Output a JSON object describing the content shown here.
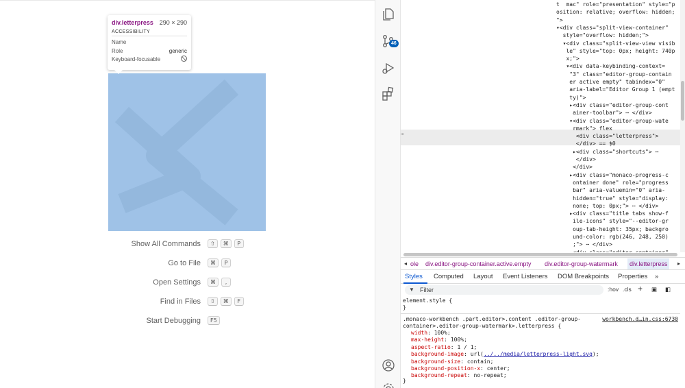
{
  "tooltip": {
    "tag": "div.letterpress",
    "dimensions": "290 × 290",
    "section": "ACCESSIBILITY",
    "rows": [
      {
        "label": "Name",
        "value": ""
      },
      {
        "label": "Role",
        "value": "generic"
      },
      {
        "label": "Keyboard-focusable",
        "value": ""
      }
    ]
  },
  "shortcuts": [
    {
      "label": "Show All Commands",
      "keys": [
        "⇧",
        "⌘",
        "P"
      ]
    },
    {
      "label": "Go to File",
      "keys": [
        "⌘",
        "P"
      ]
    },
    {
      "label": "Open Settings",
      "keys": [
        "⌘",
        ","
      ]
    },
    {
      "label": "Find in Files",
      "keys": [
        "⇧",
        "⌘",
        "F"
      ]
    },
    {
      "label": "Start Debugging",
      "keys": [
        "F5"
      ]
    }
  ],
  "activity_bar": {
    "icons": [
      "explorer-icon",
      "source-control-icon",
      "run-debug-icon",
      "extensions-icon",
      "accounts-icon",
      "manage-icon"
    ],
    "scm_badge": "46"
  },
  "dom_lines": [
    "t  mac\" role=\"presentation\" style=\"p",
    "osition: relative; overflow: hidden;",
    "\">",
    "▾<div class=\"split-view-container\"",
    "  style=\"overflow: hidden;\">",
    "  ▾<div class=\"split-view-view visib",
    "   le\" style=\"top: 0px; height: 740p",
    "   x;\">",
    "   ▾<div data-keybinding-context=",
    "    \"3\" class=\"editor-group-contain",
    "    er active empty\" tabindex=\"0\"",
    "    aria-label=\"Editor Group 1 (empt",
    "    ty)\">",
    "    ▸<div class=\"editor-group-cont",
    "     ainer-toolbar\"> ⋯ </div>",
    "    ▾<div class=\"editor-group-wate",
    "     rmark\"> flex",
    "      <div class=\"letterpress\">",
    "      </div> == $0",
    "     ▸<div class=\"shortcuts\"> ⋯ ",
    "      </div>",
    "     </div>",
    "    ▸<div class=\"monaco-progress-c",
    "     ontainer done\" role=\"progress",
    "     bar\" aria-valuemin=\"0\" aria-",
    "     hidden=\"true\" style=\"display:",
    "     none; top: 0px;\"> ⋯ </div>",
    "    ▸<div class=\"title tabs show-f",
    "     ile-icons\" style=\"--editor-gr",
    "     oup-tab-height: 35px; backgro",
    "     und-color: rgb(246, 248, 250)",
    "     ;\"> ⋯ </div>",
    "     <div class=\"editor-container\""
  ],
  "breadcrumbs": [
    "ole",
    "div.editor-group-container.active.empty",
    "div.editor-group-watermark",
    "div.letterpress"
  ],
  "tabs": [
    "Styles",
    "Computed",
    "Layout",
    "Event Listeners",
    "DOM Breakpoints",
    "Properties",
    "»"
  ],
  "filter": {
    "placeholder": "Filter",
    "hov": ":hov",
    "cls": ".cls",
    "plus": "+"
  },
  "styles": {
    "element_style_open": "element.style {",
    "element_style_close": "}",
    "rule_selector_1": ".monaco-workbench .part.editor>.content .editor-group-",
    "rule_selector_2": "container>.editor-group-watermark>.letterpress {",
    "rule_source": "workbench.d…in.css:6730",
    "declarations": [
      {
        "prop": "width",
        "value": "100%;"
      },
      {
        "prop": "max-height",
        "value": "100%;"
      },
      {
        "prop": "aspect-ratio",
        "value": "1 / 1;"
      },
      {
        "prop": "background-image",
        "value_prefix": "url(",
        "value_link": "../../media/letterpress-light.svg",
        "value_suffix": ");"
      },
      {
        "prop": "background-size",
        "value": "contain;"
      },
      {
        "prop": "background-position-x",
        "value": "center;"
      },
      {
        "prop": "background-repeat",
        "value": "no-repeat;"
      }
    ],
    "rule_close": "}"
  },
  "colors": {
    "highlight": "#9fc2e7",
    "accent": "#0b57d0",
    "badge": "#005fb8"
  }
}
